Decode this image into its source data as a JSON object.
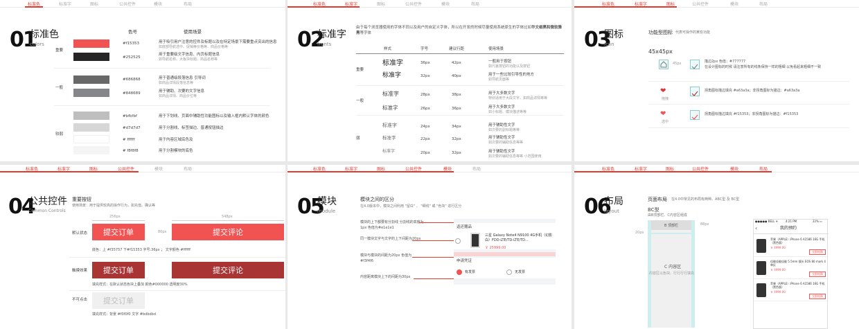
{
  "nav": [
    "标准色",
    "标准字",
    "图标",
    "公共控件",
    "模块",
    "布局"
  ],
  "colors": {
    "red": "#f15353",
    "red2": "#252525",
    "dark": "#686868",
    "mid": "#848689",
    "l1": "#bfbfbf",
    "l2": "#d7d7d7",
    "l3": "#ffffff",
    "l4": "#f8f8f8",
    "accent": "#e6392e"
  },
  "p1": {
    "num": "01",
    "title": "标准色",
    "sub": "colors",
    "col_code": "色号",
    "col_use": "使用场景",
    "group_important": "重要",
    "group_normal": "一般",
    "group_weak": "较弱",
    "rows": [
      {
        "code": "#f15353",
        "use": "用于吸引用户注意的控件及标题以及在特定场景下需要重点突出的信息",
        "hint": "如底部导航选中、促销等价格等、商品价格等"
      },
      {
        "code": "#252525",
        "use": "用于重要级文字信息、内页标题信息",
        "hint": "如导航名称、大板块标题、商品名称等"
      },
      {
        "code": "#686868",
        "use": "用于普通级段落信息 引导词",
        "hint": "如商品详情段落信息等"
      },
      {
        "code": "#848689",
        "use": "用于辅助、次要的文字信息",
        "hint": "如商品详情、商品价位等"
      },
      {
        "code": "#bfbfbf",
        "use": "用于下划线、页面中辅助性功能图标以及输入框内默认字体的颜色",
        "hint": ""
      },
      {
        "code": "#d7d7d7",
        "use": "用于分割线、标签描边、普通按钮描边",
        "hint": ""
      },
      {
        "code": "# ffffff",
        "use": "用于内容区域底色及",
        "hint": ""
      },
      {
        "code": "# f8f8f8",
        "use": "用于分割模块的底色",
        "hint": ""
      }
    ]
  },
  "p2": {
    "num": "02",
    "title": "标准字",
    "sub": "fronts",
    "desc": "由于每个浏览器使用的字体不同以及用户的自定义字体，所以在开发的时候尽量使用系统原生的字体比如",
    "desc_bold": "华文细黑和微软雅黑",
    "desc_tail": "等字体",
    "cols": [
      "样式",
      "字号",
      "建议行距",
      "使用场景"
    ],
    "g1": "重要",
    "g2": "一般",
    "g3": "弱",
    "rows": [
      {
        "style": "标准字",
        "size": "36px",
        "lh": "42px",
        "use": "一般用于按钮",
        "hint": "如尺差按钮的功能以及按钮"
      },
      {
        "style": "标准字",
        "size": "32px",
        "lh": "40px",
        "use": "用于一些比较引导性的地方",
        "hint": "如导航页面等"
      },
      {
        "style": "标准字",
        "size": "28px",
        "lh": "38px",
        "use": "用于大多数文字",
        "hint": "特别适用于大段文字，如商品详情等等"
      },
      {
        "style": "标准字",
        "size": "26px",
        "lh": "36px",
        "use": "用于大多数文字",
        "hint": "如小标题、模块描述等等"
      },
      {
        "style": "标准字",
        "size": "24px",
        "lh": "34px",
        "use": "用于辅助性文字",
        "hint": "如次要的副标题等等"
      },
      {
        "style": "标准字",
        "size": "22px",
        "lh": "32px",
        "use": "用于辅助性文字",
        "hint": "如次要的辅助信息等等"
      },
      {
        "style": "标准字",
        "size": "20px",
        "lh": "32px",
        "use": "用于辅助性文字",
        "hint": "如次要的辅助信息等等 小范围使用"
      }
    ]
  },
  "p3": {
    "num": "03",
    "title": "图标",
    "sub": "icon",
    "h": "功能型图标",
    "hnote": "代表可操作的某些功能",
    "size": "45x45px",
    "dim": "45px",
    "line1": "描边2px 色值：#777777",
    "line2": "在设计图标的时候 请注意所有的线条保持一样的粗细 以免看起来粗细不一致",
    "sel": "勾选",
    "unsel": "选中",
    "heart1": "拖拽",
    "heart2": "选中",
    "r2": "拐角图标描边填充 #a63a3a；非拐角图标为描边：",
    "r2b": "#a63a3a",
    "r3": "拐角图标描边填充 #f15353；非拐角图标为描边：#f15353"
  },
  "p4": {
    "num": "04",
    "title": "公共控件",
    "sub": "Common Controls",
    "h": "重要按钮",
    "hnote": "使用场景：用于提供较高的操作行为，如充值、确认等",
    "w1": "256px",
    "w2": "548px",
    "h80": "80px",
    "default": "默认状态",
    "press": "触摸效果",
    "disabled": "不可点击",
    "btn1": "提交订单",
    "btn2": "提交评论",
    "note1": "底色：上 #f35757 下#f15353 字号:36px ；  文字颜色 #ffffff",
    "note2": "填充样式：在默认状态色块上叠加 颜色#000000  透明度30%",
    "note3": "填充样式：背景 #f0f0f0  文字 #bdbdbd"
  },
  "p5": {
    "num": "05",
    "title": "模块",
    "sub": "module",
    "h": "模块之间的区分",
    "hnote": "在4.0版本中，模块之间利用 \"留白\" 、 \"细线\" 或 \"色块\" 进行区分",
    "n1": "模块的上下都要有分割线 分割线的高度为1px 色值为#e1e1e1",
    "n2": "同一模块文字与文字的上下间距为20px",
    "n3": "模块与模块的间距为20px 色值为#f3f4f6",
    "n4": "内容距离模块上下的间距为30px",
    "card_title": "返还赠品",
    "card_product": "三星 Galaxy Note4 N9100 4G手机（幻影白）FDD-LTE/TD-LTE/TD...",
    "card_price": "￥ 25999.00",
    "card2": "申请凭证",
    "opt1": "有发票",
    "opt2": "无发票"
  },
  "p6": {
    "num": "06",
    "title": "布局",
    "sub": "layout",
    "h": "页面布局",
    "hnote": "在4.0中常见的布局有两种。ABC型 及 BC型",
    "bc": "BC型",
    "bcnote": "由B顶部栏、C内容区组成",
    "b": "B 顶部栏",
    "c": "C 内容区",
    "cnote": "内容区以色块、行行行行填充",
    "h88": "88px",
    "w20": "20px",
    "phone_status_l": "●●●●● BELL ✈",
    "phone_time": "4:21 PM",
    "phone_bat": "22% ▭",
    "phone_title": "我的预约",
    "items": [
      {
        "name": "苹果（APPLE）iPhone 6 A1586 16G 手机（黑色版）",
        "price": "￥ 4999.00",
        "btn": "立即抢购"
      },
      {
        "name": "佳能佳能佳能 5.5mm 镜头 EOS 80 mark 4 单反",
        "price": "￥ 4999.00",
        "btn": "立即抢购"
      },
      {
        "name": "苹果（APPLE）iPhone 6 A1586 16G 手机（黑色版）",
        "price": "￥ 4999.00",
        "btn": "立即抢购"
      }
    ]
  }
}
